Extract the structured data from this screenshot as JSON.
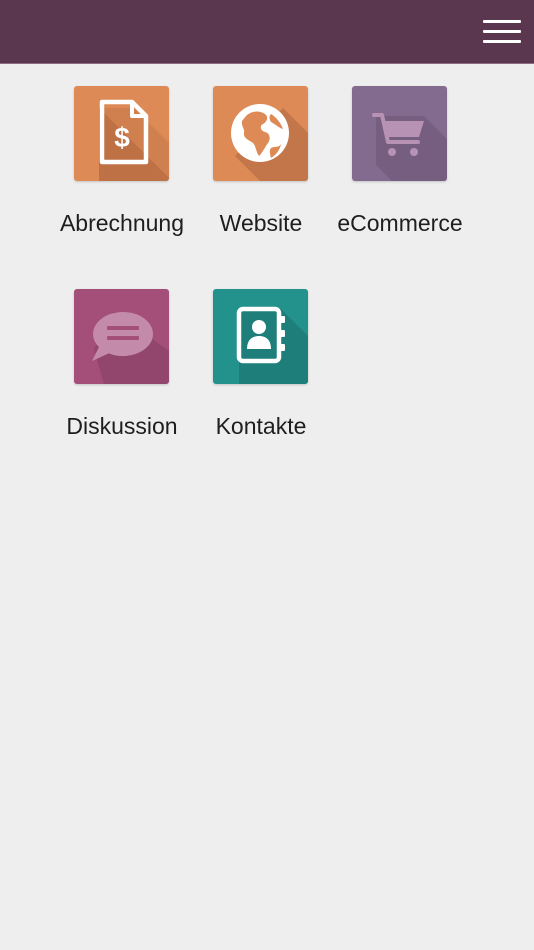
{
  "header": {
    "menu_icon": "hamburger-menu-icon",
    "background_color": "#5b374f"
  },
  "apps": [
    {
      "label": "Abrechnung",
      "icon": "invoice-dollar-icon",
      "color": "#dd8a57"
    },
    {
      "label": "Website",
      "icon": "globe-icon",
      "color": "#dd8a57"
    },
    {
      "label": "eCommerce",
      "icon": "shopping-cart-icon",
      "color": "#836b8f"
    },
    {
      "label": "Diskussion",
      "icon": "chat-bubble-icon",
      "color": "#a34f7a"
    },
    {
      "label": "Kontakte",
      "icon": "address-book-icon",
      "color": "#23918c"
    }
  ]
}
